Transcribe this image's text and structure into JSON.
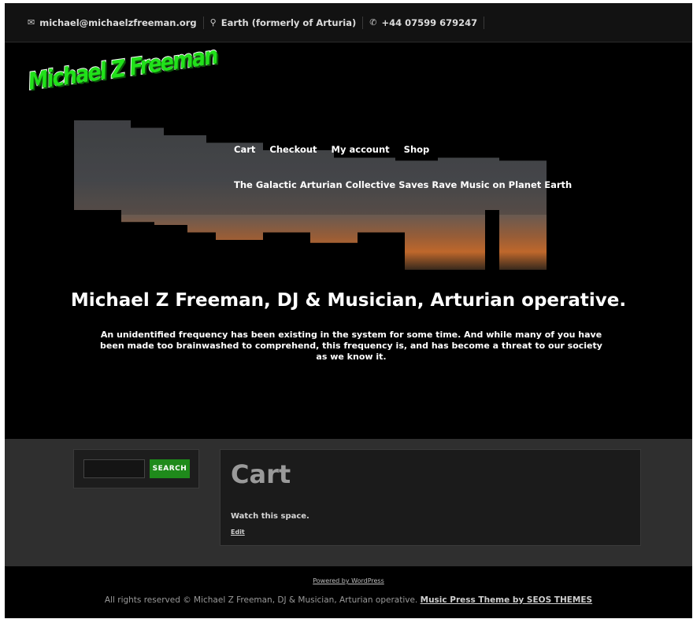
{
  "topbar": {
    "email": "michael@michaelzfreeman.org",
    "location": "Earth (formerly of Arturia)",
    "phone": "+44 07599 679247",
    "email_icon": "envelope-icon",
    "location_icon": "map-pin-icon",
    "phone_icon": "phone-icon"
  },
  "header": {
    "logo_text": "Michael Z Freeman",
    "nav": [
      "Cart",
      "Checkout",
      "My account",
      "Shop"
    ],
    "tagline": "The Galactic Arturian Collective Saves Rave Music on Planet Earth",
    "hero_title": "Michael Z Freeman, DJ & Musician, Arturian operative.",
    "hero_text": "An unidentified frequency has been existing in the system for some time. And while many of you have been made too brainwashed to comprehend, this frequency is, and has become a threat to our society as we know it."
  },
  "sidebar": {
    "search_placeholder": "",
    "search_button": "SEARCH"
  },
  "article": {
    "title": "Cart",
    "body": "Watch this space.",
    "edit_link": "Edit"
  },
  "footer": {
    "powered": "Powered by WordPress",
    "copyright": "All rights reserved © Michael Z Freeman, DJ & Musician, Arturian operative.",
    "theme_credit": "Music Press Theme by SEOS THEMES"
  },
  "colors": {
    "accent_green": "#1f8a1b",
    "logo_green": "#21e11a",
    "background": "#000000",
    "content_bg": "#2f2f2f"
  }
}
